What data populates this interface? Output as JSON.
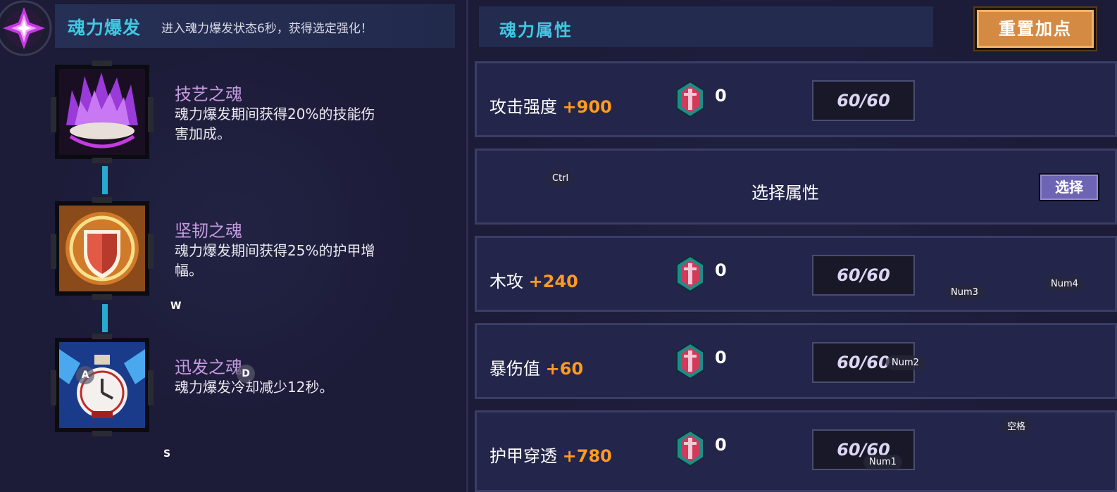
{
  "burst_panel": {
    "title": "魂力爆发",
    "description": "进入魂力爆发状态6秒，获得选定强化！"
  },
  "talents": [
    {
      "name": "技艺之魂",
      "desc": "魂力爆发期间获得20%的技能伤害加成。",
      "desc_lines": [
        "魂力爆发期间获得20%的技能伤",
        "害加成。"
      ],
      "icon": "purple-flame-icon"
    },
    {
      "name": "坚韧之魂",
      "desc": "魂力爆发期间获得25%的护甲增幅。",
      "desc_lines": [
        "魂力爆发期间获得25%的护甲增",
        "幅。"
      ],
      "icon": "shield-icon"
    },
    {
      "name": "迅发之魂",
      "desc": "魂力爆发冷却减少12秒。",
      "desc_lines": [
        "魂力爆发冷却减少12秒。"
      ],
      "icon": "clock-icon"
    }
  ],
  "attributes_panel": {
    "title": "魂力属性",
    "reset_label": "重置加点"
  },
  "attributes": [
    {
      "name": "攻击强度",
      "bonus": "+900",
      "count": "0",
      "cap": "60/60"
    },
    {
      "type": "select",
      "title": "选择属性",
      "button": "选择"
    },
    {
      "name": "木攻",
      "bonus": "+240",
      "count": "0",
      "cap": "60/60"
    },
    {
      "name": "暴伤值",
      "bonus": "+60",
      "count": "0",
      "cap": "60/60"
    },
    {
      "name": "护甲穿透",
      "bonus": "+780",
      "count": "0",
      "cap": "60/60"
    }
  ],
  "key_hints": {
    "ctrl": "Ctrl",
    "w": "W",
    "a": "A",
    "d": "D",
    "s": "S",
    "num1": "Num1",
    "num2": "Num2",
    "num3": "Num3",
    "num4": "Num4",
    "space": "空格"
  },
  "colors": {
    "accent_title": "#40c8e2",
    "bonus": "#ff9b1e",
    "talent_name": "#c59be0",
    "reset_button": "#d58a44",
    "select_button": "#6d64b4"
  }
}
